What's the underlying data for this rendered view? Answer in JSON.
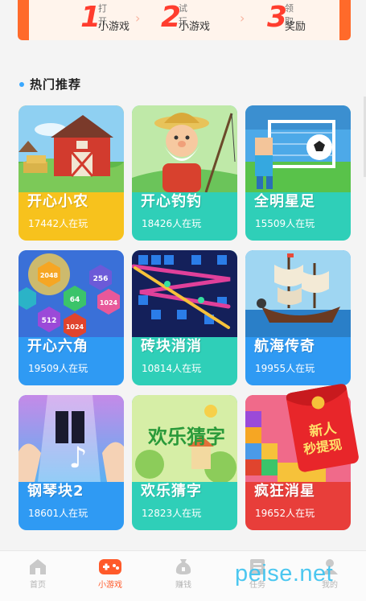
{
  "steps": [
    {
      "number": "1",
      "small": "打开",
      "label": "小游戏"
    },
    {
      "number": "2",
      "small": "试玩",
      "label": "小游戏"
    },
    {
      "number": "3",
      "small": "领取",
      "label": "奖励"
    }
  ],
  "section": {
    "title": "热门推荐"
  },
  "games": [
    {
      "name": "开心小农",
      "players": "17442人在玩"
    },
    {
      "name": "开心钓钓",
      "players": "18426人在玩"
    },
    {
      "name": "全明星足",
      "players": "15509人在玩"
    },
    {
      "name": "开心六角",
      "players": "19509人在玩"
    },
    {
      "name": "砖块消消",
      "players": "10814人在玩"
    },
    {
      "name": "航海传奇",
      "players": "19955人在玩"
    },
    {
      "name": "钢琴块2",
      "players": "18601人在玩"
    },
    {
      "name": "欢乐猜字",
      "players": "12823人在玩"
    },
    {
      "name": "疯狂消星",
      "players": "19652人在玩"
    }
  ],
  "card_art_text": {
    "hex_numbers": [
      "2048",
      "256",
      "64",
      "1024",
      "512",
      "1024"
    ],
    "guess_title": "欢乐猜字"
  },
  "red_packet": {
    "line1": "新人",
    "line2": "秒提现"
  },
  "nav": [
    {
      "label": "首页",
      "icon": "home-icon"
    },
    {
      "label": "小游戏",
      "icon": "gamepad-icon"
    },
    {
      "label": "赚钱",
      "icon": "money-bag-icon"
    },
    {
      "label": "任务",
      "icon": "task-icon"
    },
    {
      "label": "我的",
      "icon": "profile-icon"
    }
  ],
  "watermark": "peise.net",
  "colors": {
    "accent": "#ff5a2a",
    "yellow": "#f7c21d",
    "teal": "#2fcfb8",
    "blue": "#2f9af3",
    "section_dot": "#3aa8ff"
  }
}
